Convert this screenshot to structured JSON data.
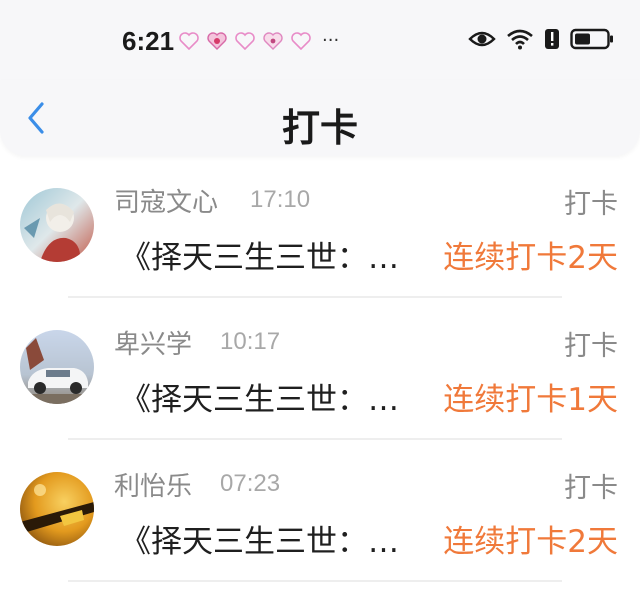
{
  "status_bar": {
    "time": "6:21",
    "notification_icons": [
      "heart-notification-icon",
      "heart-notification-icon",
      "heart-notification-icon",
      "heart-notification-icon",
      "heart-notification-icon"
    ],
    "more": "···"
  },
  "header": {
    "title": "打卡"
  },
  "colors": {
    "accent": "#f0793a",
    "back": "#3b8ee8"
  },
  "checkins": [
    {
      "name": "司寇文心",
      "time": "17:10",
      "action": "打卡",
      "book": "《择天三生三世：…",
      "streak": "连续打卡2天"
    },
    {
      "name": "卑兴学",
      "time": "10:17",
      "action": "打卡",
      "book": "《择天三生三世：…",
      "streak": "连续打卡1天"
    },
    {
      "name": "利怡乐",
      "time": "07:23",
      "action": "打卡",
      "book": "《择天三生三世：…",
      "streak": "连续打卡2天"
    }
  ]
}
